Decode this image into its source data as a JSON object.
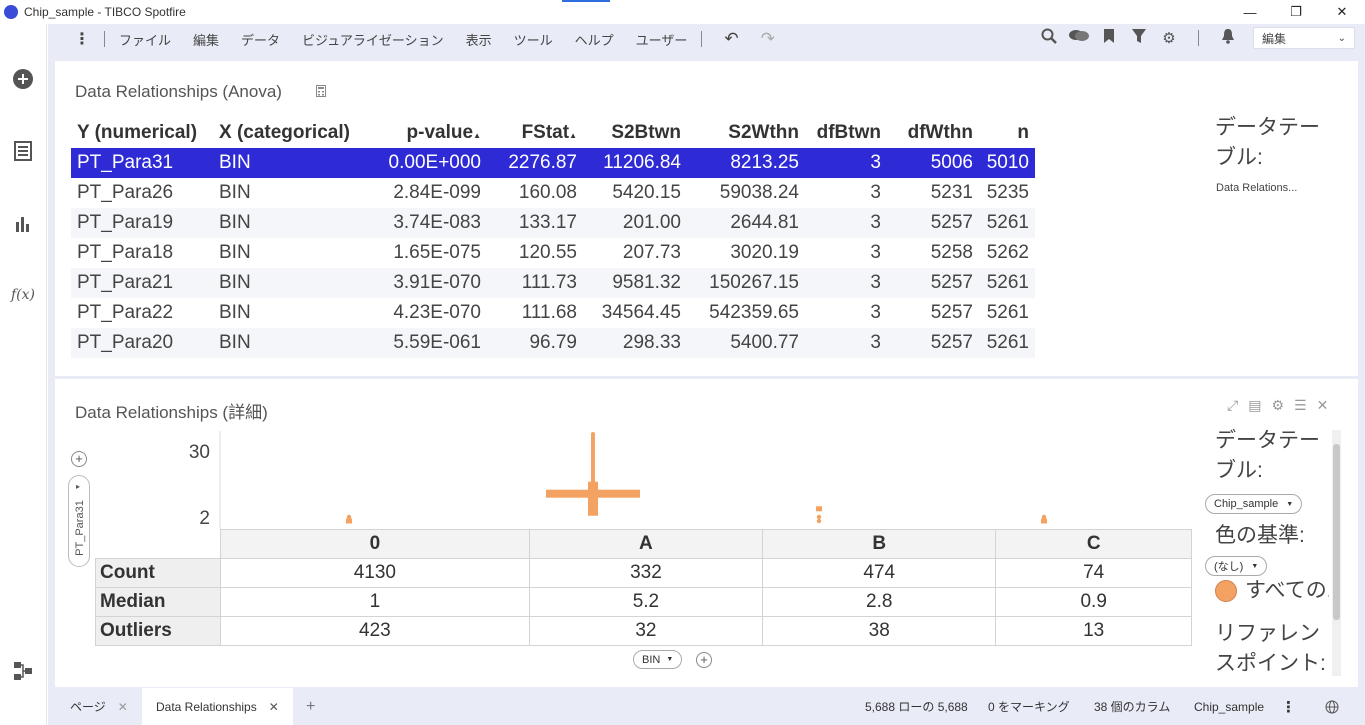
{
  "window": {
    "title": "Chip_sample - TIBCO Spotfire",
    "minimize": "—",
    "restore": "❐",
    "close": "✕"
  },
  "menu": {
    "items": [
      "ファイル",
      "編集",
      "データ",
      "ビジュアライゼーション",
      "表示",
      "ツール",
      "ヘルプ",
      "ユーザー"
    ],
    "mode": "編集"
  },
  "anova_panel": {
    "title": "Data Relationships (Anova)",
    "columns": [
      "Y (numerical)",
      "X (categorical)",
      "p-value",
      "FStat",
      "S2Btwn",
      "S2Wthn",
      "dfBtwn",
      "dfWthn",
      "n"
    ],
    "rows": [
      [
        "PT_Para31",
        "BIN",
        "0.00E+000",
        "2276.87",
        "11206.84",
        "8213.25",
        "3",
        "5006",
        "5010"
      ],
      [
        "PT_Para26",
        "BIN",
        "2.84E-099",
        "160.08",
        "5420.15",
        "59038.24",
        "3",
        "5231",
        "5235"
      ],
      [
        "PT_Para19",
        "BIN",
        "3.74E-083",
        "133.17",
        "201.00",
        "2644.81",
        "3",
        "5257",
        "5261"
      ],
      [
        "PT_Para18",
        "BIN",
        "1.65E-075",
        "120.55",
        "207.73",
        "3020.19",
        "3",
        "5258",
        "5262"
      ],
      [
        "PT_Para21",
        "BIN",
        "3.91E-070",
        "111.73",
        "9581.32",
        "150267.15",
        "3",
        "5257",
        "5261"
      ],
      [
        "PT_Para22",
        "BIN",
        "4.23E-070",
        "111.68",
        "34564.45",
        "542359.65",
        "3",
        "5257",
        "5261"
      ],
      [
        "PT_Para20",
        "BIN",
        "5.59E-061",
        "96.79",
        "298.33",
        "5400.77",
        "3",
        "5257",
        "5261"
      ]
    ],
    "side": {
      "label": "データテーブル:",
      "value": "Data Relations..."
    }
  },
  "detail_panel": {
    "title": "Data Relationships (詳細)",
    "y_axis_label": "PT_Para31",
    "x_axis_label": "BIN",
    "side": {
      "table_label": "データテーブル:",
      "table_value": "Chip_sample",
      "color_label": "色の基準:",
      "color_value": "(なし)",
      "legend_item": "すべての...",
      "ref_label": "リファレンスポイント:",
      "accent_color": "#f4a261"
    },
    "stats": {
      "row_labels": [
        "Count",
        "Median",
        "Outliers"
      ],
      "rows": [
        [
          "4130",
          "332",
          "474",
          "74"
        ],
        [
          "1",
          "5.2",
          "2.8",
          "0.9"
        ],
        [
          "423",
          "32",
          "38",
          "13"
        ]
      ]
    }
  },
  "chart_data": {
    "type": "box",
    "categories": [
      "0",
      "A",
      "B",
      "C"
    ],
    "y_ticks": [
      "30",
      "2"
    ],
    "ylabel": "PT_Para31",
    "xlabel": "BIN",
    "median": [
      1,
      5.2,
      2.8,
      0.9
    ],
    "count": [
      4130,
      332,
      474,
      74
    ],
    "outliers": [
      423,
      32,
      38,
      13
    ],
    "color": "#f4a261"
  },
  "statusbar": {
    "tabs": [
      "ページ",
      "Data Relationships"
    ],
    "add": "+",
    "rows_info": "5,688 ローの 5,688",
    "marking_info": "0 をマーキング",
    "columns_info": "38 個のカラム",
    "table_info": "Chip_sample"
  }
}
